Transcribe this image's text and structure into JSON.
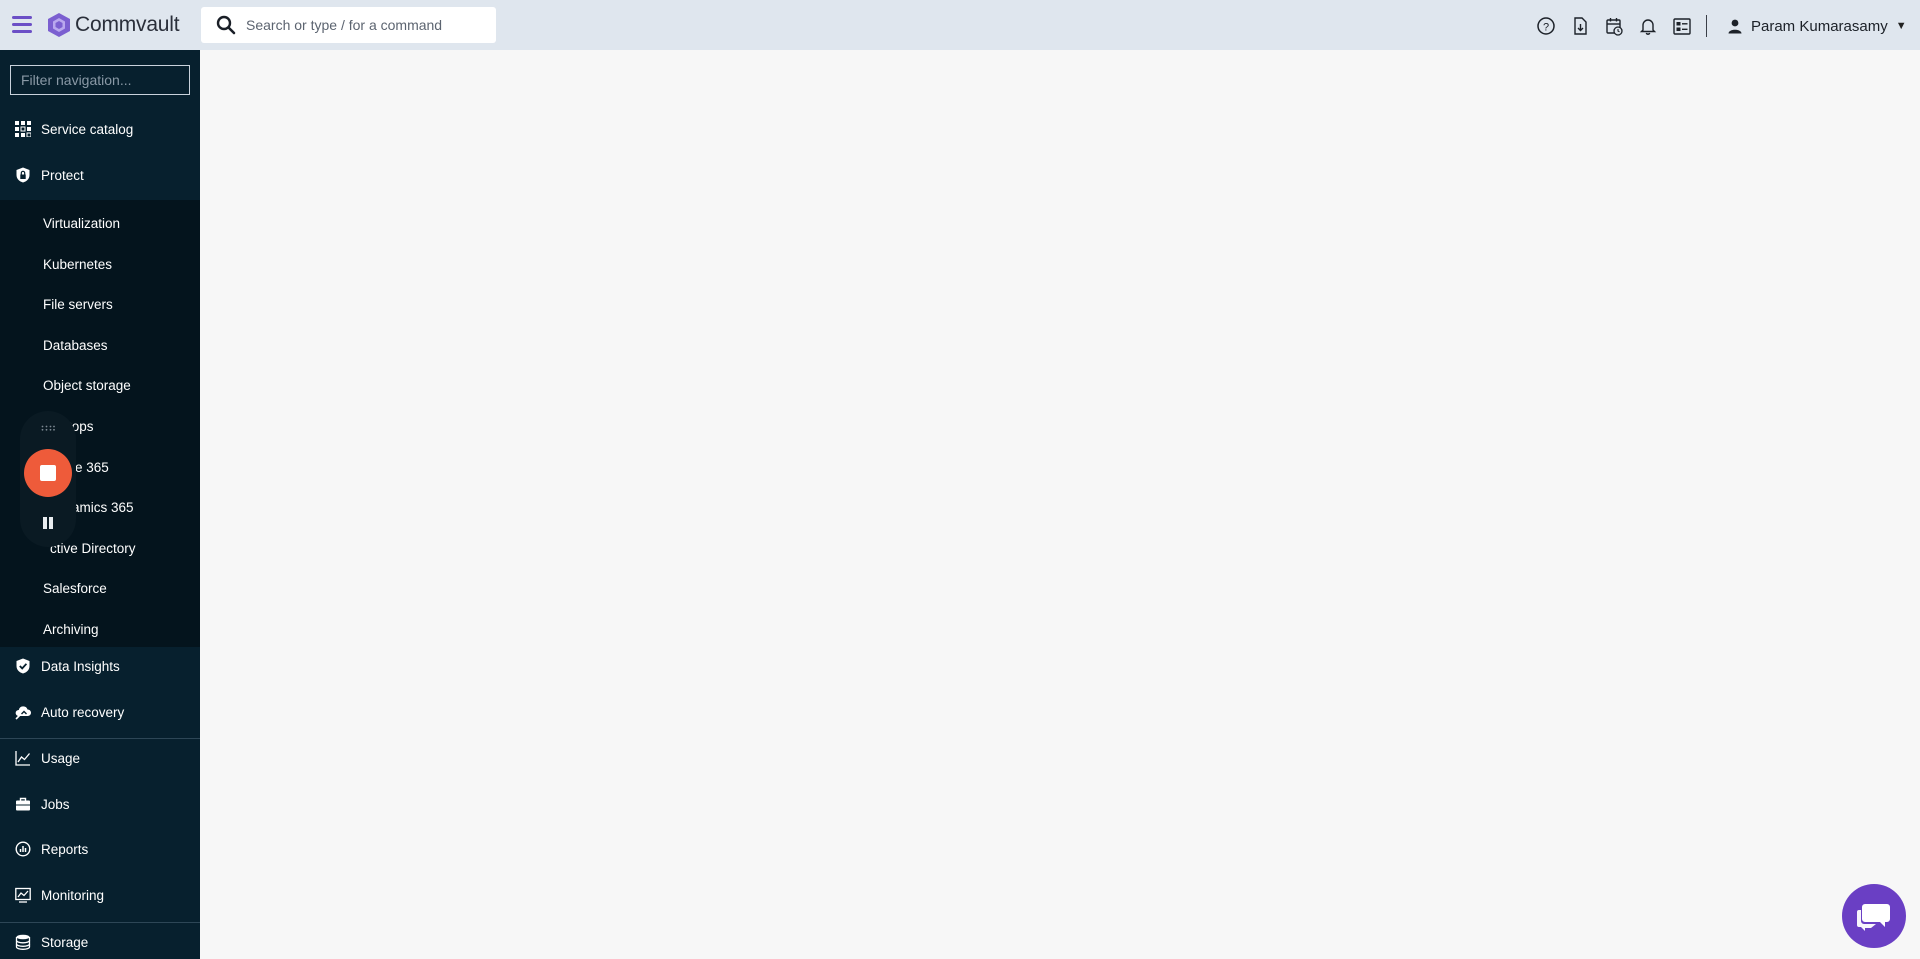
{
  "header": {
    "brand": "Commvault",
    "search_placeholder": "Search or type / for a command",
    "user_name": "Param Kumarasamy",
    "icons": [
      "help-icon",
      "download-report-icon",
      "schedule-icon",
      "bell-icon",
      "task-list-icon"
    ]
  },
  "sidebar": {
    "filter_placeholder": "Filter navigation...",
    "top_items": [
      {
        "label": "Service catalog",
        "icon": "grid-icon"
      },
      {
        "label": "Protect",
        "icon": "shield-lock-icon"
      }
    ],
    "protect_items": [
      {
        "label": "Virtualization"
      },
      {
        "label": "Kubernetes"
      },
      {
        "label": "File servers"
      },
      {
        "label": "Databases"
      },
      {
        "label": "Object storage"
      },
      {
        "label": "tops"
      },
      {
        "label": "e 365"
      },
      {
        "label": "amics 365"
      },
      {
        "label": "ctive Directory"
      },
      {
        "label": "Salesforce"
      },
      {
        "label": "Archiving"
      }
    ],
    "bottom_items": [
      {
        "label": "Data Insights",
        "icon": "shield-check-icon"
      },
      {
        "label": "Auto recovery",
        "icon": "cloud-recovery-icon"
      },
      {
        "label": "Usage",
        "icon": "trend-chart-icon"
      },
      {
        "label": "Jobs",
        "icon": "briefcase-icon"
      },
      {
        "label": "Reports",
        "icon": "report-chart-icon"
      },
      {
        "label": "Monitoring",
        "icon": "monitor-chart-icon"
      },
      {
        "label": "Storage",
        "icon": "database-icon"
      }
    ]
  },
  "colors": {
    "topbar": "#dfe6ee",
    "sidebar": "#07202e",
    "accent": "#6b4fc6",
    "record": "#ee5b3a",
    "chat": "#6a3fc4"
  }
}
